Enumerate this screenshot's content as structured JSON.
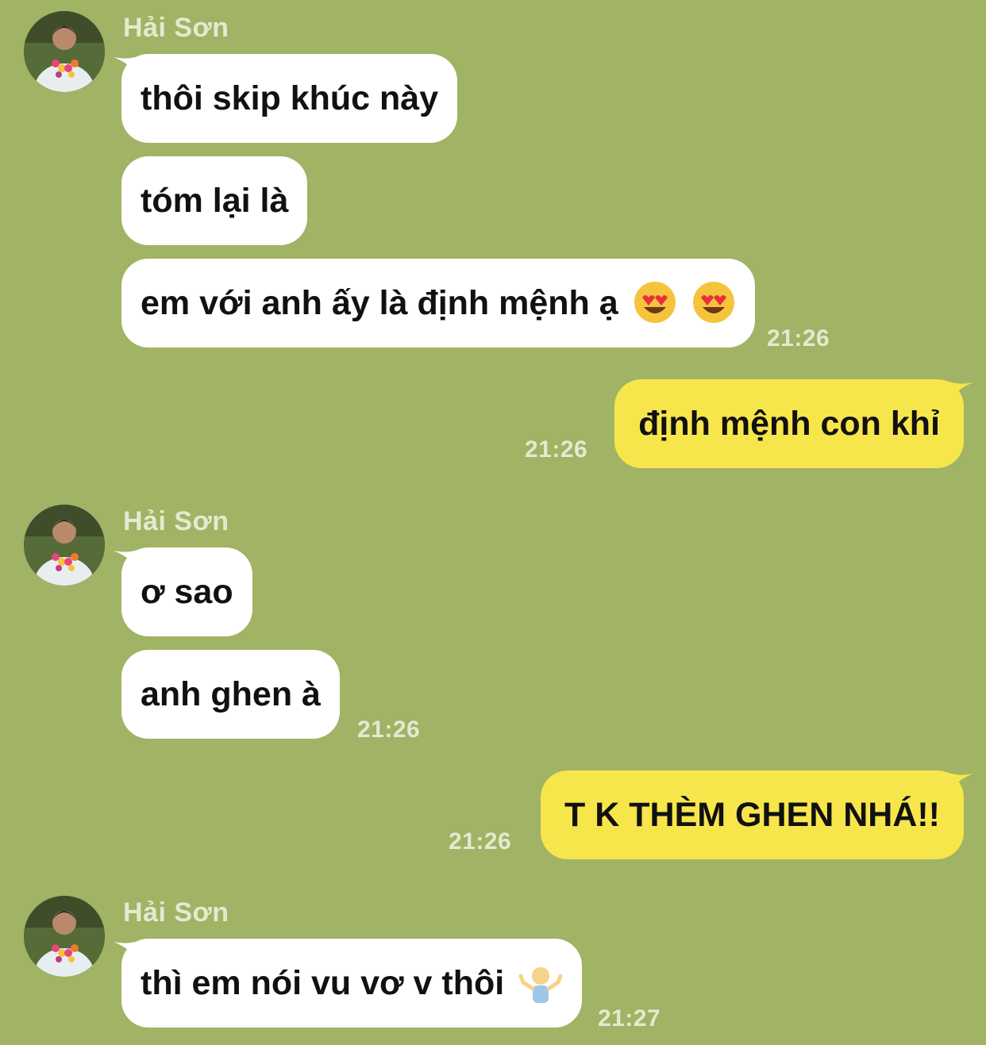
{
  "messages": [
    {
      "sender": "Hải Sơn"
    },
    {
      "text": "thôi skip khúc này"
    },
    {
      "text": "tóm lại là"
    },
    {
      "text": "em với anh ấy là định mệnh ạ",
      "emoji": [
        "heart-eyes",
        "heart-eyes"
      ],
      "time": "21:26"
    },
    {
      "text": "định mệnh con khỉ",
      "time": "21:26"
    },
    {
      "sender": "Hải Sơn"
    },
    {
      "text": "ơ sao"
    },
    {
      "text": "anh ghen à",
      "time": "21:26"
    },
    {
      "text": "T K THÈM GHEN NHÁ!!",
      "time": "21:26"
    },
    {
      "sender": "Hải Sơn"
    },
    {
      "text": "thì em nói vu vơ v thôi",
      "emoji": [
        "person-shrugging"
      ],
      "time": "21:27"
    }
  ],
  "colors": {
    "background": "#a1b364",
    "incoming_bubble": "#ffffff",
    "outgoing_bubble": "#f7e64b",
    "meta_text": "#e3ead0"
  }
}
